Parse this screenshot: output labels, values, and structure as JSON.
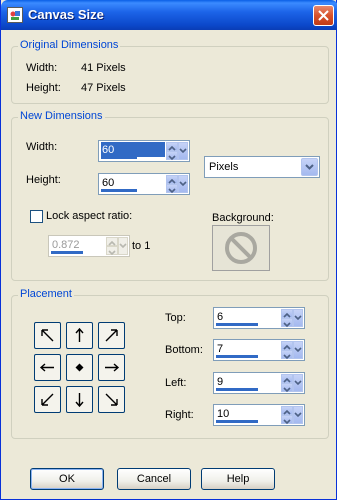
{
  "window": {
    "title": "Canvas Size"
  },
  "original": {
    "title": "Original Dimensions",
    "width_label": "Width:",
    "width_value": "41 Pixels",
    "height_label": "Height:",
    "height_value": "47 Pixels"
  },
  "new_dims": {
    "title": "New Dimensions",
    "width_label": "Width:",
    "width_value": "60",
    "height_label": "Height:",
    "height_value": "60",
    "units": "Pixels",
    "lock_label": "Lock aspect ratio:",
    "lock_checked": false,
    "ratio_value": "0.872",
    "to_label": "to 1",
    "background_label": "Background:"
  },
  "placement": {
    "title": "Placement",
    "top_label": "Top:",
    "top_value": "6",
    "bottom_label": "Bottom:",
    "bottom_value": "7",
    "left_label": "Left:",
    "left_value": "9",
    "right_label": "Right:",
    "right_value": "10"
  },
  "buttons": {
    "ok": "OK",
    "cancel": "Cancel",
    "help": "Help"
  },
  "colors": {
    "accent": "#316AC5",
    "group_title": "#0046D5",
    "titlebar": "#0A5FE6"
  }
}
